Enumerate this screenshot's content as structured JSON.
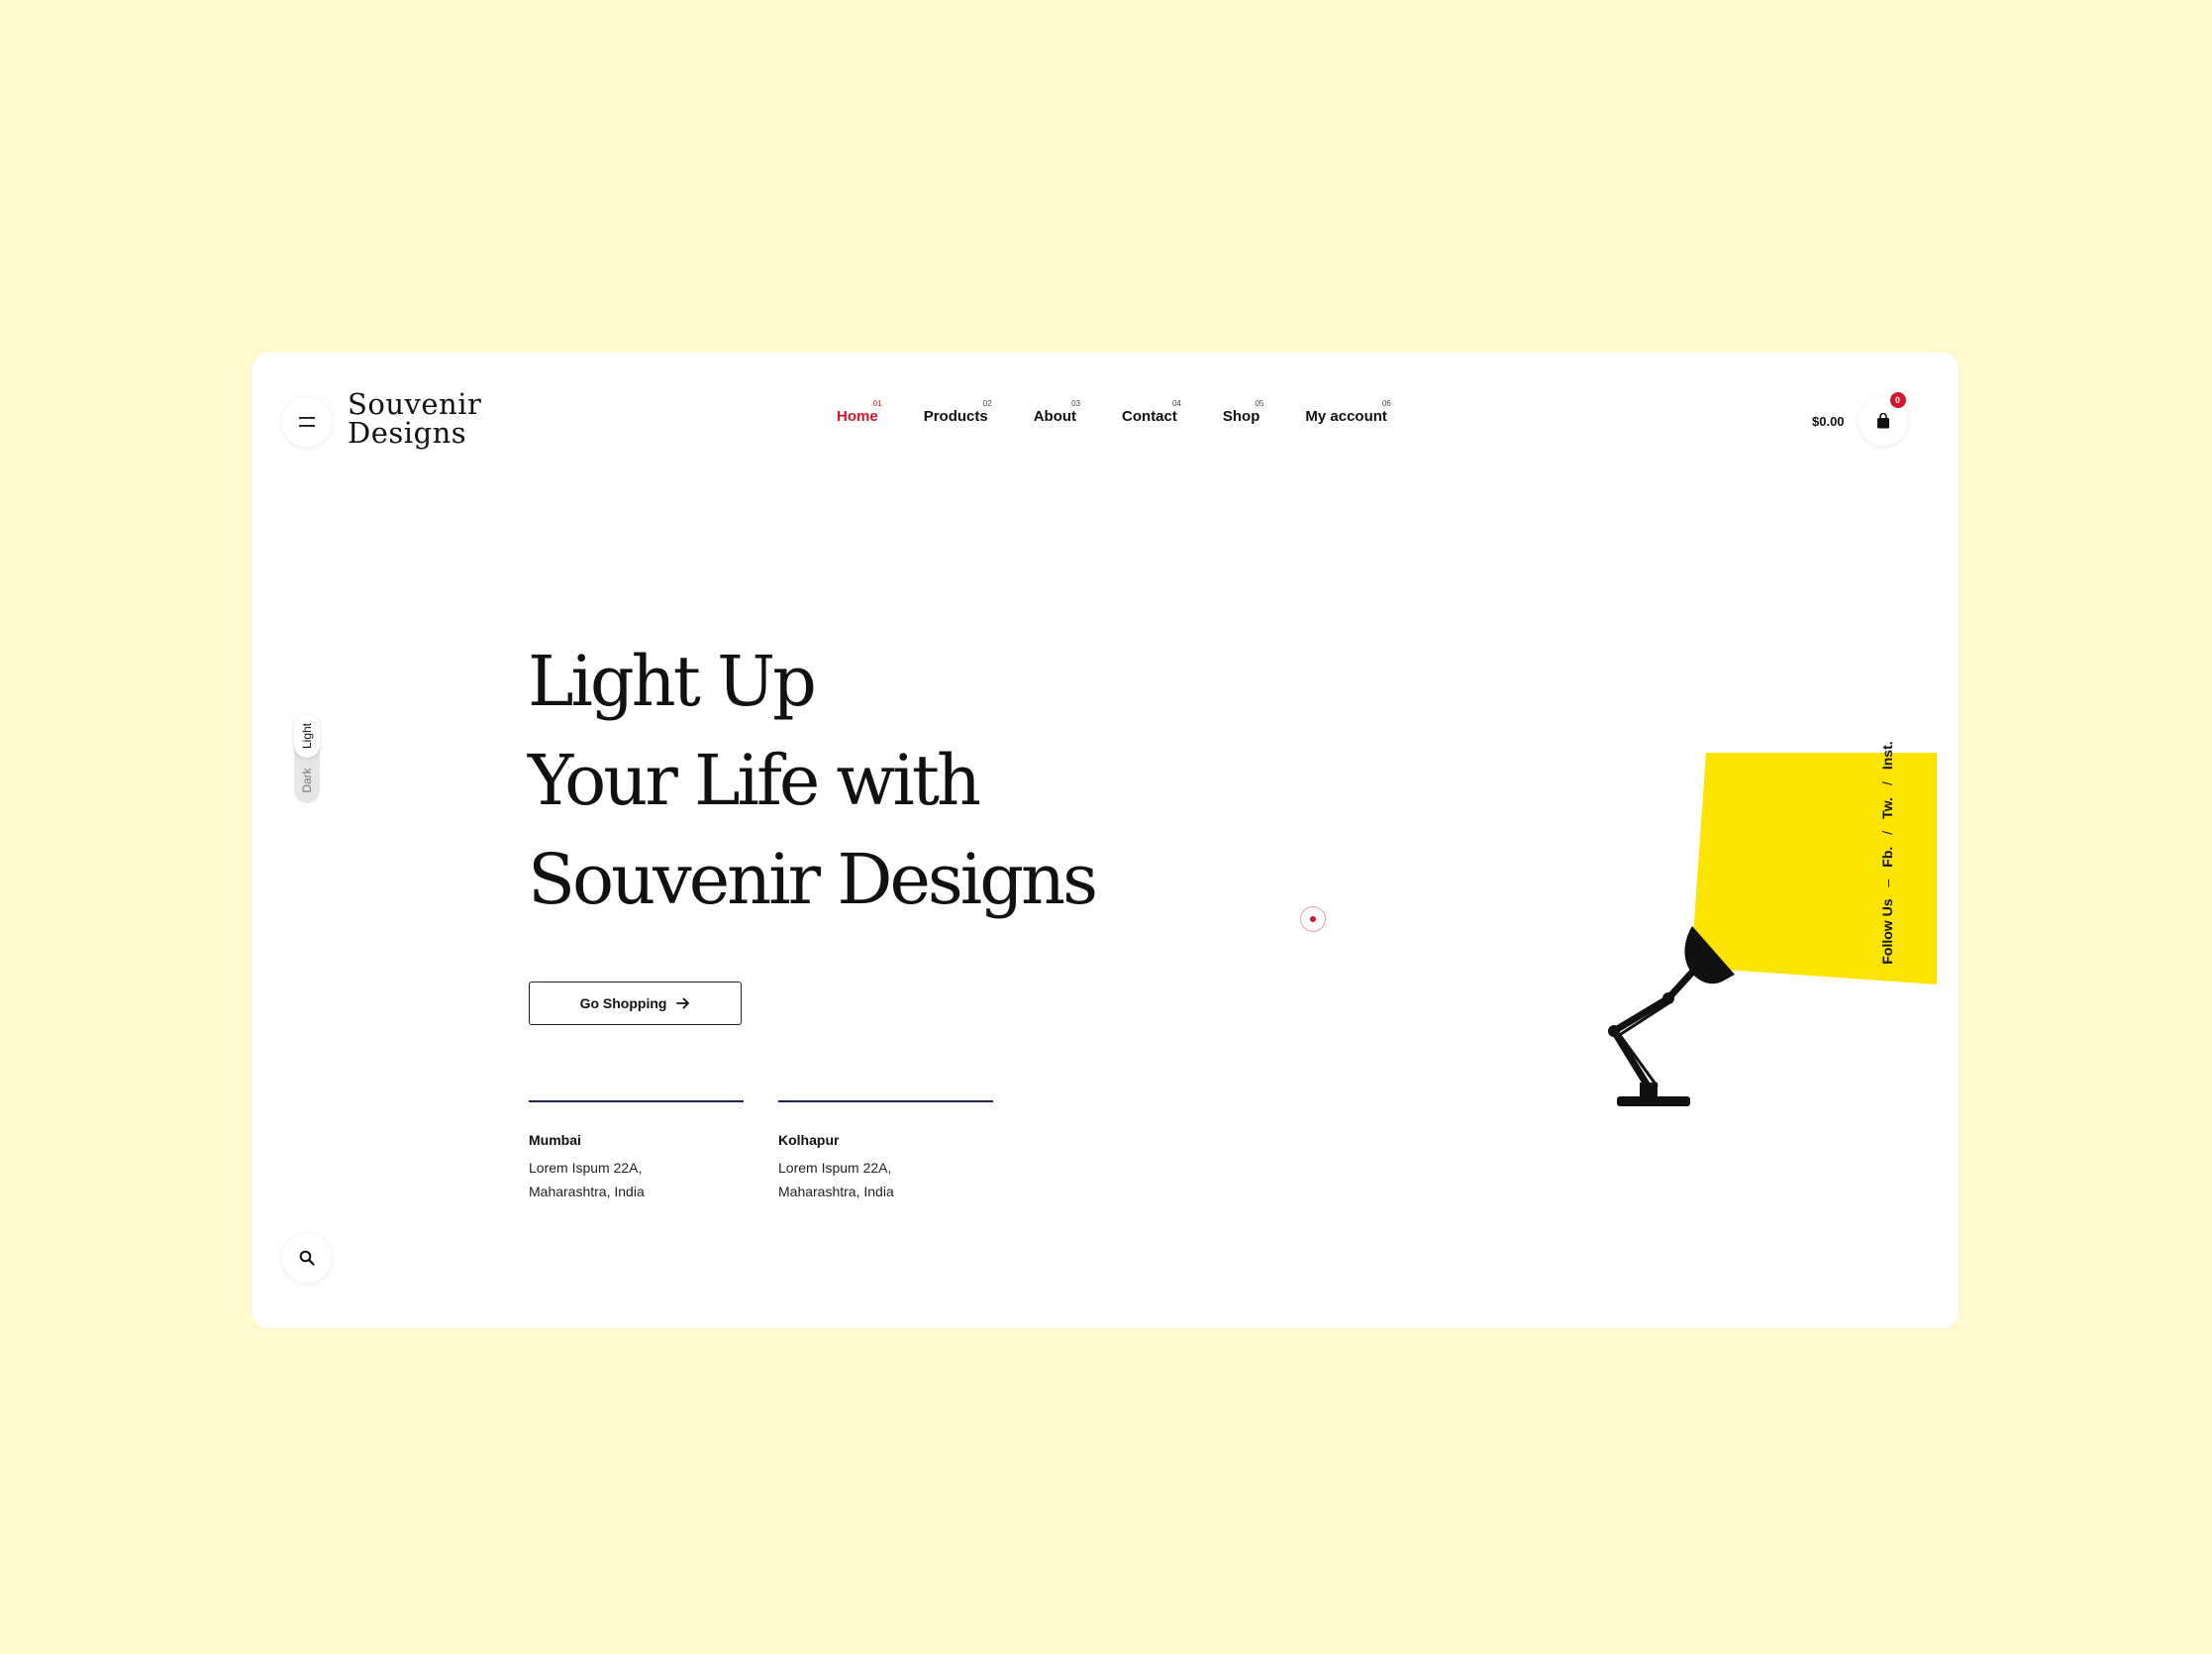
{
  "brand": {
    "logo_line1": "Souvenir",
    "logo_line2": "Designs"
  },
  "nav": [
    {
      "number": "01",
      "label": "Home",
      "active": true
    },
    {
      "number": "02",
      "label": "Products"
    },
    {
      "number": "03",
      "label": "About"
    },
    {
      "number": "04",
      "label": "Contact"
    },
    {
      "number": "05",
      "label": "Shop"
    },
    {
      "number": "06",
      "label": "My account"
    }
  ],
  "cart": {
    "amount": "$0.00",
    "count": "0"
  },
  "theme_toggle": {
    "light": "Light",
    "dark": "Dark",
    "selected": "Light"
  },
  "hero": {
    "line1": "Light Up",
    "line2": "Your Life with",
    "line3": "Souvenir Designs",
    "cta": "Go Shopping"
  },
  "locations": [
    {
      "city": "Mumbai",
      "line1": "Lorem Ispum 22A,",
      "line2": "Maharashtra, India"
    },
    {
      "city": "Kolhapur",
      "line1": "Lorem Ispum 22A,",
      "line2": "Maharashtra, India"
    }
  ],
  "social": {
    "label": "Follow Us",
    "dash": "–",
    "links": [
      "Fb.",
      "Tw.",
      "Inst."
    ],
    "separator": "/"
  },
  "icons": {
    "menu": "menu-icon",
    "search": "search-icon",
    "cart": "shopping-bag-icon",
    "arrow": "arrow-right-icon",
    "illustration": "desk-lamp-icon"
  },
  "colors": {
    "page_background": "#fdf9cd",
    "card": "#ffffff",
    "accent_red": "#d1152a",
    "lamp_light": "#fbe500",
    "divider": "#1b2456"
  }
}
